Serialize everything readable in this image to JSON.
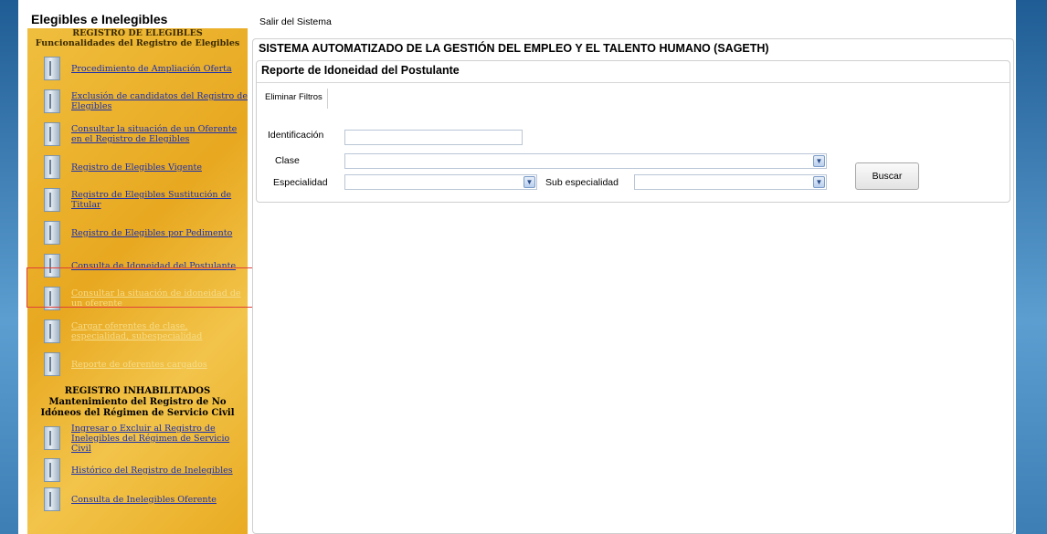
{
  "sidebar": {
    "header": "Elegibles e Inelegibles",
    "section1": {
      "title": "REGISTRO DE ELEGIBLES",
      "subtitle": "Funcionalidades del Registro de Elegibles"
    },
    "items1": [
      {
        "label": "Procedimiento de Ampliación Oferta",
        "enabled": true
      },
      {
        "label": "Exclusión de candidatos del Registro de Elegibles",
        "enabled": true
      },
      {
        "label": "Consultar la situación de un Oferente en el Registro de Elegibles",
        "enabled": true
      },
      {
        "label": "Registro de Elegibles Vigente",
        "enabled": true
      },
      {
        "label": "Registro de Elegibles Sustitución de Titular",
        "enabled": true
      },
      {
        "label": "Registro de Elegibles por Pedimento",
        "enabled": true
      },
      {
        "label": "Consulta de Idoneidad del Postulante",
        "enabled": true,
        "selected": true
      },
      {
        "label": "Consultar la situación de idoneidad de un oferente",
        "enabled": false
      },
      {
        "label": "Cargar oferentes de clase, especialidad, subespecialidad",
        "enabled": false
      },
      {
        "label": "Reporte de oferentes cargados",
        "enabled": false
      }
    ],
    "section2": {
      "title": "REGISTRO INHABILITADOS",
      "subtitle": "Mantenimiento del Registro de No Idóneos del Régimen de Servicio Civil"
    },
    "items2": [
      {
        "label": "Ingresar o Excluir al Registro de Inelegibles del Régimen de Servicio Civil",
        "enabled": true
      },
      {
        "label": "Histórico del Registro de Inelegibles",
        "enabled": true
      },
      {
        "label": "Consulta de Inelegibles Oferente",
        "enabled": true
      }
    ]
  },
  "top_link": "Salir del Sistema",
  "main": {
    "title": "SISTEMA AUTOMATIZADO DE LA GESTIÓN DEL EMPLEO Y EL TALENTO HUMANO (SAGETH)",
    "report": {
      "title": "Reporte de Idoneidad del Postulante",
      "tab_label": "Eliminar Filtros",
      "form": {
        "identificacion_label": "Identificación",
        "identificacion_value": "",
        "clase_label": "Clase",
        "clase_value": "",
        "especialidad_label": "Especialidad",
        "especialidad_value": "",
        "sub_especialidad_label": "Sub especialidad",
        "sub_especialidad_value": "",
        "search_button": "Buscar"
      }
    }
  },
  "colors": {
    "sidebar_gold": "#e8a820",
    "link_blue": "#1a2fb0",
    "highlight_red": "#e0403a",
    "frame_blue": "#2f6fa6"
  }
}
